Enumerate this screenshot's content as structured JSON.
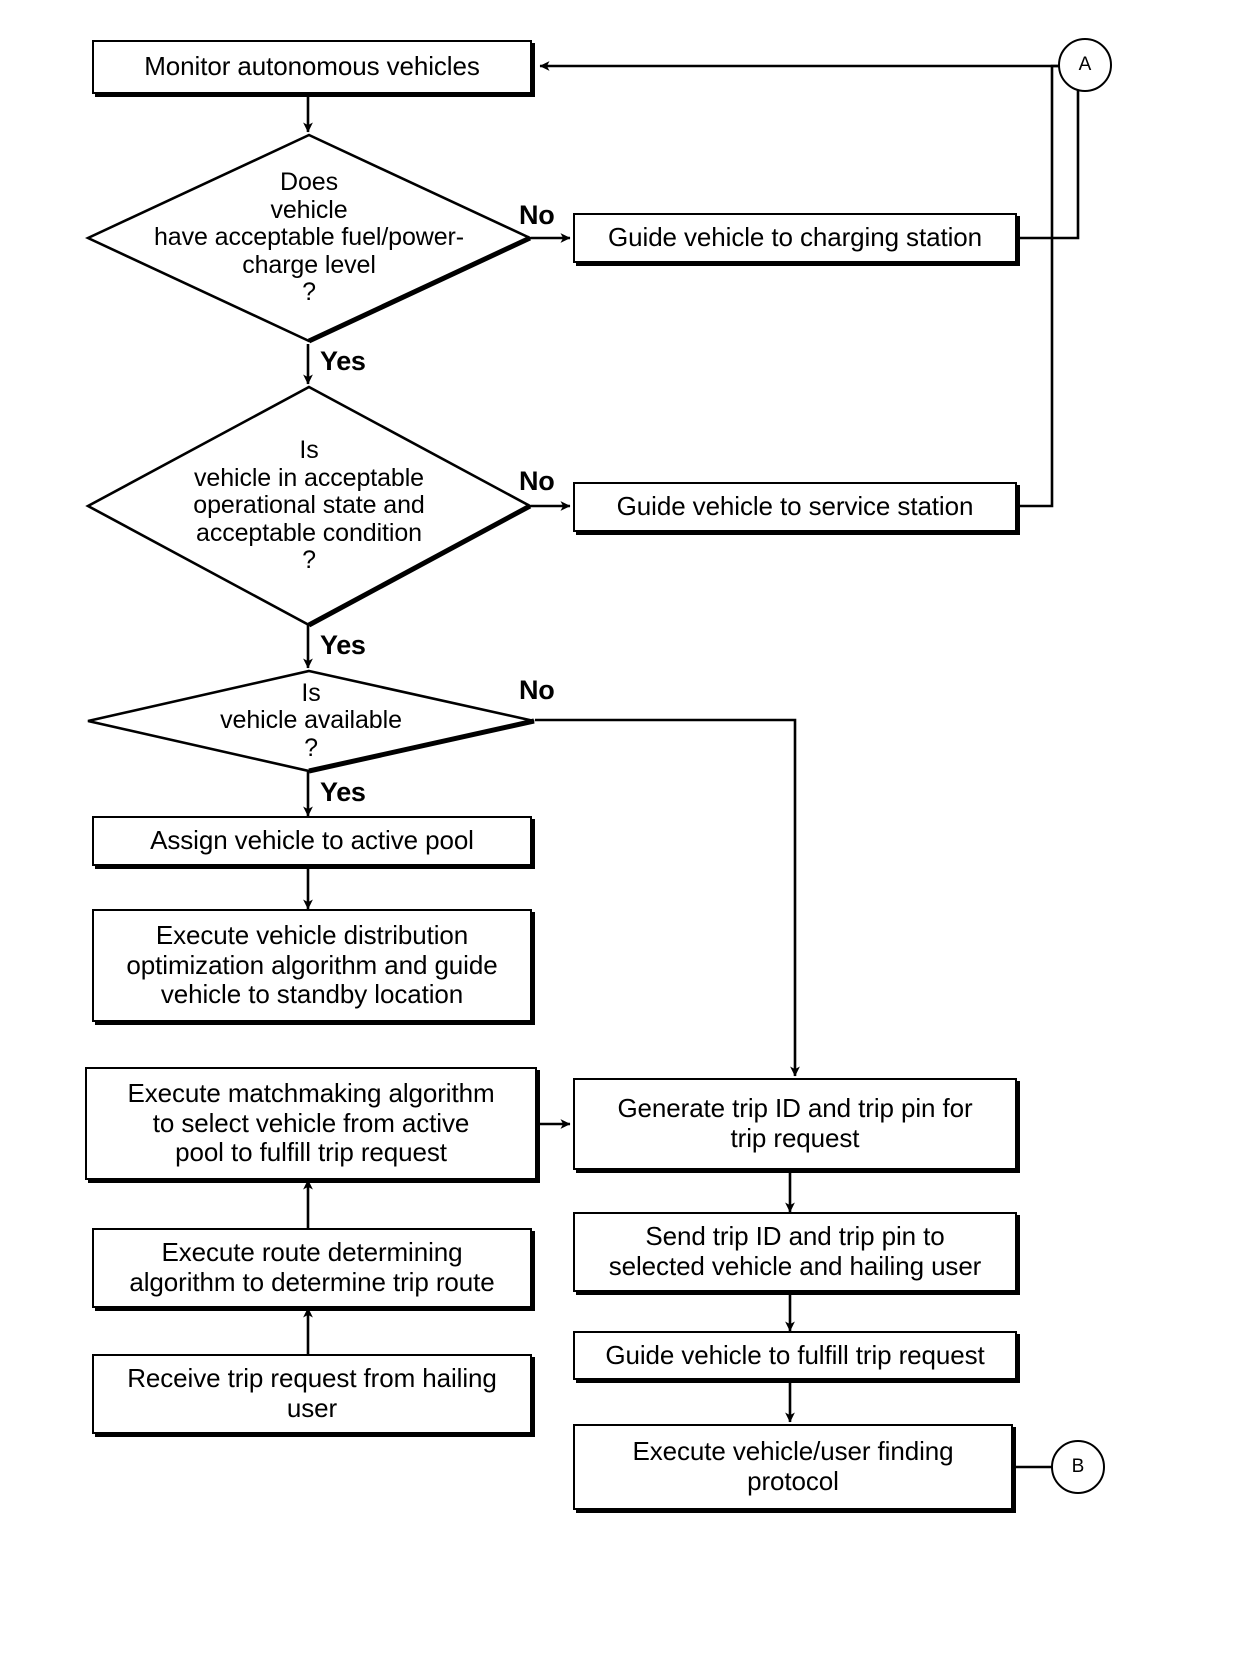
{
  "diagram": {
    "title": "Autonomous vehicle fleet management flowchart",
    "type": "flowchart",
    "stroke_color": "#000000",
    "fill_color": "#ffffff"
  },
  "nodes": {
    "monitor": "Monitor autonomous vehicles",
    "decision_fuel": "Does\nvehicle\nhave acceptable fuel/power-\ncharge level\n?",
    "charging_station": "Guide vehicle to charging station",
    "decision_condition": "Is\nvehicle in acceptable\noperational state and\nacceptable condition\n?",
    "service_station": "Guide vehicle to service station",
    "decision_available": "Is\nvehicle available\n?",
    "assign_pool": "Assign vehicle to active pool",
    "distribution": "Execute vehicle distribution\noptimization algorithm and guide\nvehicle to standby location",
    "matchmaking": "Execute matchmaking algorithm\nto select vehicle from active\npool to fulfill trip request",
    "route": "Execute route determining\nalgorithm to determine trip route",
    "receive_request": "Receive trip request from hailing\nuser",
    "generate_trip": "Generate trip ID and trip pin for\ntrip request",
    "send_trip": "Send trip ID and trip pin to\nselected vehicle and hailing user",
    "guide_fulfill": "Guide vehicle to fulfill trip request",
    "finding_protocol": "Execute vehicle/user finding\nprotocol"
  },
  "edge_labels": {
    "fuel_no": "No",
    "fuel_yes": "Yes",
    "condition_no": "No",
    "condition_yes": "Yes",
    "available_no": "No",
    "available_yes": "Yes"
  },
  "connectors": {
    "a": "A",
    "b": "B"
  }
}
